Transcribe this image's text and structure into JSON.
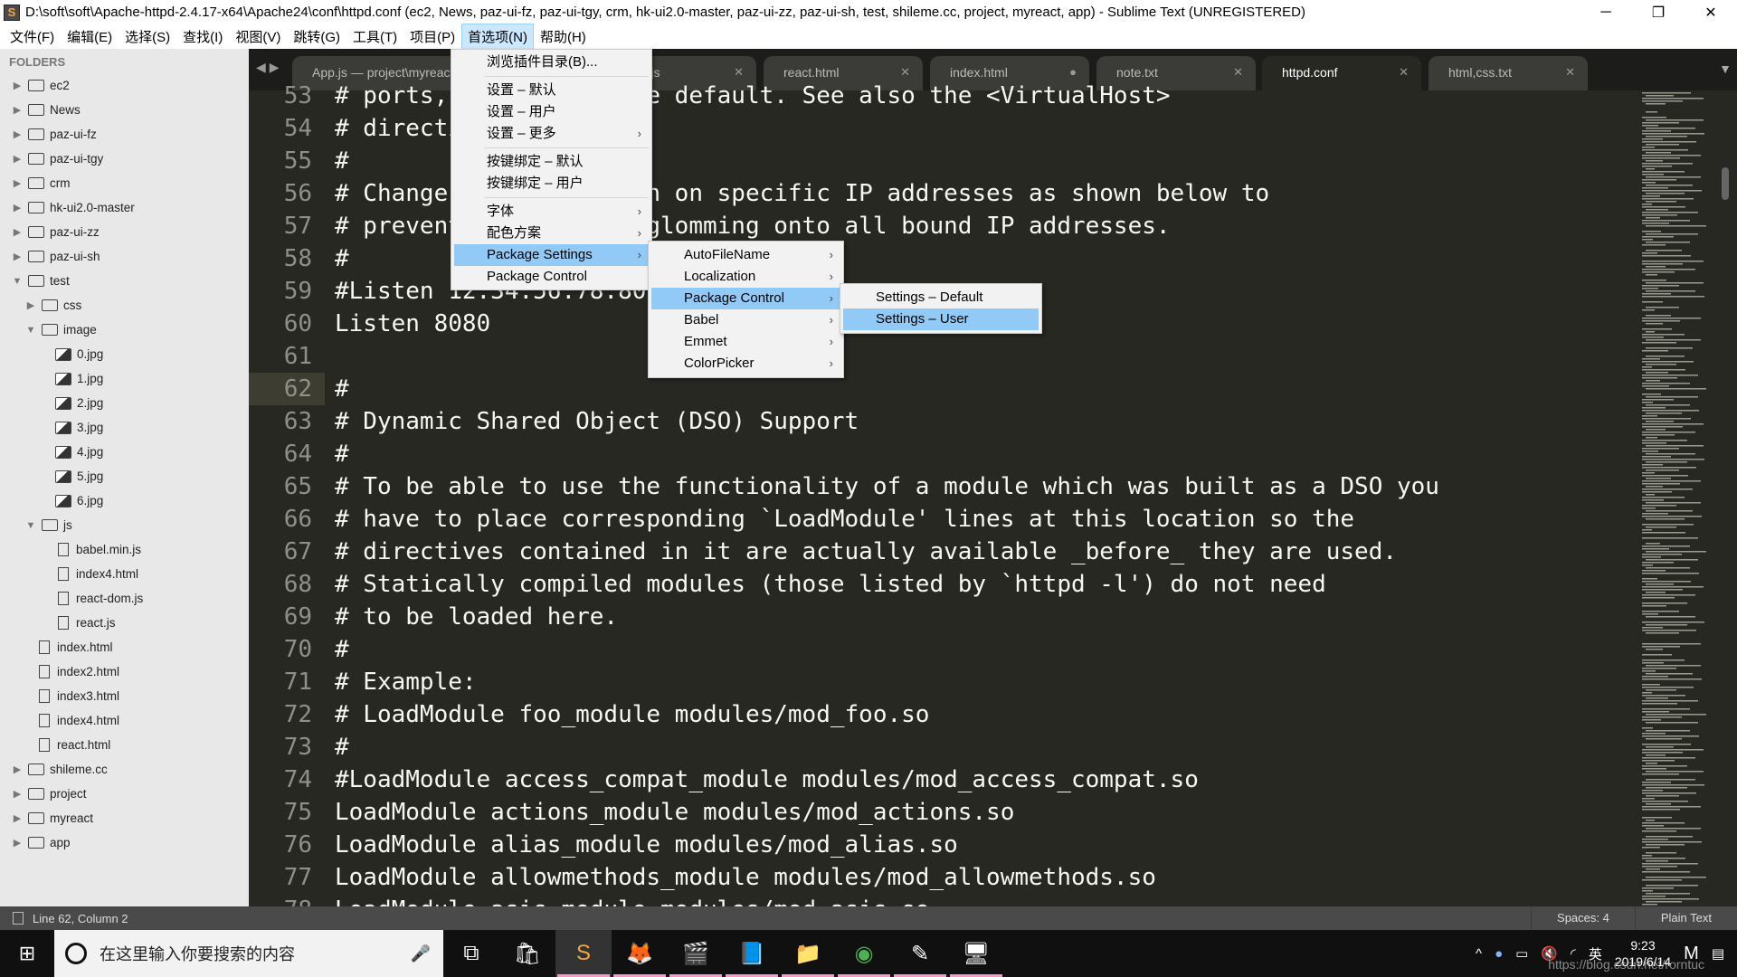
{
  "window": {
    "title": "D:\\soft\\soft\\Apache-httpd-2.4.17-x64\\Apache24\\conf\\httpd.conf (ec2, News, paz-ui-fz, paz-ui-tgy, crm, hk-ui2.0-master, paz-ui-zz, paz-ui-sh, test, shileme.cc, project, myreact, app) - Sublime Text (UNREGISTERED)",
    "minimize": "─",
    "maximize": "❐",
    "close": "✕"
  },
  "menubar": [
    "文件(F)",
    "编辑(E)",
    "选择(S)",
    "查找(I)",
    "视图(V)",
    "跳转(G)",
    "工具(T)",
    "项目(P)",
    "首选项(N)",
    "帮助(H)"
  ],
  "sidebar": {
    "header": "FOLDERS",
    "items": [
      {
        "label": "ec2",
        "type": "folder",
        "depth": 0,
        "open": false
      },
      {
        "label": "News",
        "type": "folder",
        "depth": 0,
        "open": false
      },
      {
        "label": "paz-ui-fz",
        "type": "folder",
        "depth": 0,
        "open": false
      },
      {
        "label": "paz-ui-tgy",
        "type": "folder",
        "depth": 0,
        "open": false
      },
      {
        "label": "crm",
        "type": "folder",
        "depth": 0,
        "open": false
      },
      {
        "label": "hk-ui2.0-master",
        "type": "folder",
        "depth": 0,
        "open": false
      },
      {
        "label": "paz-ui-zz",
        "type": "folder",
        "depth": 0,
        "open": false
      },
      {
        "label": "paz-ui-sh",
        "type": "folder",
        "depth": 0,
        "open": false
      },
      {
        "label": "test",
        "type": "folder",
        "depth": 0,
        "open": true
      },
      {
        "label": "css",
        "type": "folder",
        "depth": 1,
        "open": false
      },
      {
        "label": "image",
        "type": "folder",
        "depth": 1,
        "open": true
      },
      {
        "label": "0.jpg",
        "type": "image",
        "depth": 2
      },
      {
        "label": "1.jpg",
        "type": "image",
        "depth": 2
      },
      {
        "label": "2.jpg",
        "type": "image",
        "depth": 2
      },
      {
        "label": "3.jpg",
        "type": "image",
        "depth": 2
      },
      {
        "label": "4.jpg",
        "type": "image",
        "depth": 2
      },
      {
        "label": "5.jpg",
        "type": "image",
        "depth": 2
      },
      {
        "label": "6.jpg",
        "type": "image",
        "depth": 2
      },
      {
        "label": "js",
        "type": "folder",
        "depth": 1,
        "open": true
      },
      {
        "label": "babel.min.js",
        "type": "file",
        "depth": 2
      },
      {
        "label": "index4.html",
        "type": "file",
        "depth": 2
      },
      {
        "label": "react-dom.js",
        "type": "file",
        "depth": 2
      },
      {
        "label": "react.js",
        "type": "file",
        "depth": 2
      },
      {
        "label": "index.html",
        "type": "file",
        "depth": 1
      },
      {
        "label": "index2.html",
        "type": "file",
        "depth": 1
      },
      {
        "label": "index3.html",
        "type": "file",
        "depth": 1
      },
      {
        "label": "index4.html",
        "type": "file",
        "depth": 1
      },
      {
        "label": "react.html",
        "type": "file",
        "depth": 1
      },
      {
        "label": "shileme.cc",
        "type": "folder",
        "depth": 0,
        "open": false
      },
      {
        "label": "project",
        "type": "folder",
        "depth": 0,
        "open": false
      },
      {
        "label": "myreact",
        "type": "folder",
        "depth": 0,
        "open": false
      },
      {
        "label": "app",
        "type": "folder",
        "depth": 0,
        "open": false
      }
    ]
  },
  "tabs": [
    {
      "label": "App.js — project\\myreact",
      "close": "✕"
    },
    {
      "label": "index.js",
      "close": "✕"
    },
    {
      "label": "react.html",
      "close": "✕"
    },
    {
      "label": "index.html",
      "close": "●"
    },
    {
      "label": "note.txt",
      "close": "✕"
    },
    {
      "label": "httpd.conf",
      "close": "✕",
      "active": true
    },
    {
      "label": "html,css.txt",
      "close": "✕"
    }
  ],
  "editor": {
    "current_line": 62,
    "lines": [
      {
        "n": "53",
        "t": "# ports, instead of the default. See also the <VirtualHost>"
      },
      {
        "n": "54",
        "t": "# directive."
      },
      {
        "n": "55",
        "t": "#"
      },
      {
        "n": "56",
        "t": "# Change this to Listen on specific IP addresses as shown below to"
      },
      {
        "n": "57",
        "t": "# prevent Apache from glomming onto all bound IP addresses."
      },
      {
        "n": "58",
        "t": "#"
      },
      {
        "n": "59",
        "t": "#Listen 12.34.56.78:80"
      },
      {
        "n": "60",
        "t": "Listen 8080"
      },
      {
        "n": "61",
        "t": ""
      },
      {
        "n": "62",
        "t": "#"
      },
      {
        "n": "63",
        "t": "# Dynamic Shared Object (DSO) Support"
      },
      {
        "n": "64",
        "t": "#"
      },
      {
        "n": "65",
        "t": "# To be able to use the functionality of a module which was built as a DSO you"
      },
      {
        "n": "66",
        "t": "# have to place corresponding `LoadModule' lines at this location so the"
      },
      {
        "n": "67",
        "t": "# directives contained in it are actually available _before_ they are used."
      },
      {
        "n": "68",
        "t": "# Statically compiled modules (those listed by `httpd -l') do not need"
      },
      {
        "n": "69",
        "t": "# to be loaded here."
      },
      {
        "n": "70",
        "t": "#"
      },
      {
        "n": "71",
        "t": "# Example:"
      },
      {
        "n": "72",
        "t": "# LoadModule foo_module modules/mod_foo.so"
      },
      {
        "n": "73",
        "t": "#"
      },
      {
        "n": "74",
        "t": "#LoadModule access_compat_module modules/mod_access_compat.so"
      },
      {
        "n": "75",
        "t": "LoadModule actions_module modules/mod_actions.so"
      },
      {
        "n": "76",
        "t": "LoadModule alias_module modules/mod_alias.so"
      },
      {
        "n": "77",
        "t": "LoadModule allowmethods_module modules/mod_allowmethods.so"
      },
      {
        "n": "78",
        "t": "LoadModule asis_module modules/mod_asis.so"
      }
    ]
  },
  "menu_preferences": [
    {
      "label": "浏览插件目录(B)..."
    },
    {
      "sep": true
    },
    {
      "label": "设置 – 默认"
    },
    {
      "label": "设置 – 用户"
    },
    {
      "label": "设置 – 更多",
      "sub": true
    },
    {
      "sep": true
    },
    {
      "label": "按键绑定 – 默认"
    },
    {
      "label": "按键绑定 – 用户"
    },
    {
      "sep": true
    },
    {
      "label": "字体",
      "sub": true
    },
    {
      "label": "配色方案",
      "sub": true
    },
    {
      "label": "Package Settings",
      "sub": true,
      "hl": true
    },
    {
      "label": "Package Control"
    }
  ],
  "menu_package_settings": [
    {
      "label": "AutoFileName",
      "sub": true
    },
    {
      "label": "Localization",
      "sub": true
    },
    {
      "label": "Package Control",
      "sub": true,
      "hl": true
    },
    {
      "label": "Babel",
      "sub": true
    },
    {
      "label": "Emmet",
      "sub": true
    },
    {
      "label": "ColorPicker",
      "sub": true
    }
  ],
  "menu_package_control": [
    {
      "label": "Settings – Default"
    },
    {
      "label": "Settings – User",
      "hl": true
    }
  ],
  "statusbar": {
    "position": "Line 62, Column 2",
    "indent": "Spaces: 4",
    "syntax": "Plain Text"
  },
  "taskbar": {
    "search_placeholder": "在这里输入你要搜索的内容",
    "time": "9:23",
    "date": "2019/6/14",
    "ime": "英",
    "watermark": "https://blog.csdn.net/rorntuc",
    "apps": [
      "task-view",
      "store",
      "sublime-text",
      "firefox",
      "video-editor",
      "notepad",
      "file-explorer",
      "chrome",
      "pen-app",
      "remote-desktop"
    ]
  },
  "colors": {
    "editor_bg": "#272822",
    "sidebar_bg": "#e8e8e8",
    "menu_highlight": "#91c9f7",
    "taskbar_running": "#f49ac8"
  }
}
